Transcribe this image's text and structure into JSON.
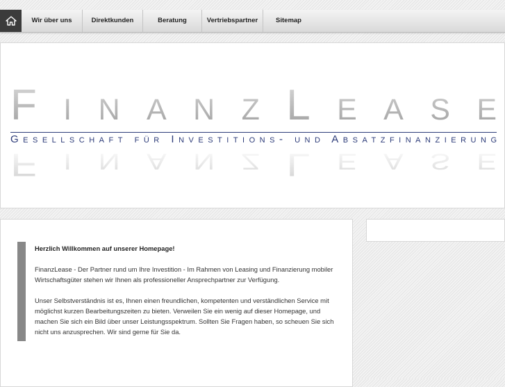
{
  "nav": {
    "home_icon": "home-icon",
    "items": [
      "Wir über uns",
      "Direktkunden",
      "Beratung",
      "Vertriebspartner",
      "Sitemap"
    ]
  },
  "logo": {
    "title": "FinanzLease",
    "subtitle": "Gesellschaft für Investitions- und Absatzfinanzierung",
    "colors": {
      "title_gray": "#b4b4b4",
      "subtitle_blue": "#2b3a78"
    }
  },
  "content": {
    "heading": "Herzlich Willkommen auf unserer Homepage!",
    "paragraph1": "FinanzLease - Der Partner rund um Ihre Investition - Im Rahmen von Leasing und Finanzierung mobiler Wirtschaftsgüter stehen wir Ihnen als professioneller Ansprechpartner zur Verfügung.",
    "paragraph2": "Unser Selbstverständnis ist es, Ihnen einen freundlichen, kompetenten und verständlichen Service mit möglichst kurzen Bearbeitungszeiten zu bieten. Verweilen Sie ein wenig auf dieser Homepage, und machen Sie sich ein Bild über unser Leistungsspektrum. Sollten Sie Fragen haben, so scheuen Sie sich nicht uns anzusprechen. Wir sind gerne für Sie da."
  }
}
